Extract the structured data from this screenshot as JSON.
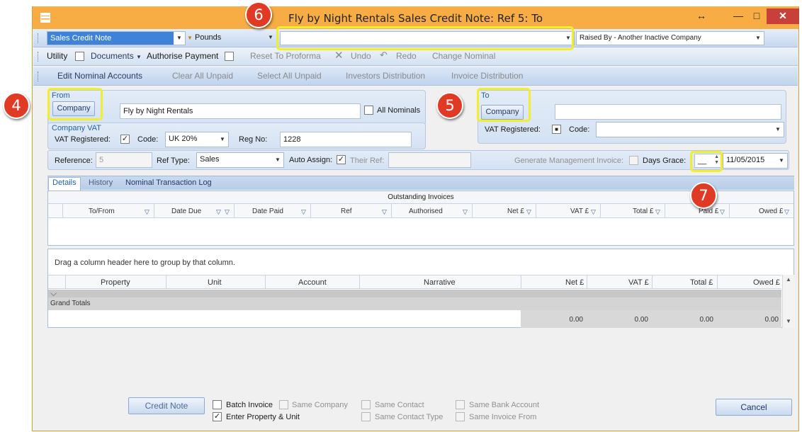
{
  "window": {
    "title": "Fly by Night Rentals Sales Credit Note: Ref 5: To",
    "controls": {
      "restore": "↔",
      "minimize": "—",
      "maximize": "□",
      "close": "✕"
    }
  },
  "toolbar1": {
    "doc_type": "Sales Credit Note",
    "currency": "Pounds",
    "middle_combo": "",
    "raised_by": "Raised By - Another Inactive Company"
  },
  "toolbar2": {
    "utility": "Utility",
    "documents": "Documents",
    "authorise_payment": "Authorise Payment",
    "reset_to_proforma": "Reset To Proforma",
    "undo": "Undo",
    "redo": "Redo",
    "change_nominal": "Change Nominal"
  },
  "toolbar3": {
    "edit_nominal": "Edit Nominal Accounts",
    "clear_all_unpaid": "Clear All Unpaid",
    "select_all_unpaid": "Select All Unpaid",
    "investors_distribution": "Investors Distribution",
    "invoice_distribution": "Invoice Distribution"
  },
  "from": {
    "label": "From",
    "company_button": "Company",
    "company_name": "Fly by Night Rentals",
    "all_nominals": "All Nominals",
    "company_vat": "Company VAT",
    "vat_registered": "VAT Registered:",
    "code_label": "Code:",
    "code_value": "UK 20%",
    "reg_no_label": "Reg No:",
    "reg_no_value": "1228"
  },
  "to": {
    "label": "To",
    "company_button": "Company",
    "company_name": "",
    "vat_registered": "VAT Registered:",
    "code_label": "Code:",
    "code_value": ""
  },
  "reference": {
    "reference_label": "Reference:",
    "reference_value": "5",
    "ref_type_label": "Ref Type:",
    "ref_type_value": "Sales",
    "auto_assign": "Auto Assign:",
    "their_ref": "Their Ref:",
    "their_ref_value": "",
    "generate_mgmt": "Generate Management Invoice:",
    "days_grace": "Days Grace:",
    "days_grace_value": "__",
    "date_value": "11/05/2015"
  },
  "tabs": [
    "Details",
    "History",
    "Nominal Transaction Log"
  ],
  "outstanding": {
    "title": "Outstanding Invoices",
    "columns": [
      "To/From",
      "Date Due",
      "Date Paid",
      "Ref",
      "Authorised",
      "Net £",
      "VAT £",
      "Total £",
      "Paid £",
      "Owed £"
    ]
  },
  "lines": {
    "group_hint": "Drag a column header here to group by that column.",
    "columns": [
      "Property",
      "Unit",
      "Account",
      "Narrative",
      "Net £",
      "VAT £",
      "Total £",
      "Owed £"
    ],
    "grand_totals": "Grand Totals",
    "totals": [
      "0.00",
      "0.00",
      "0.00",
      "0.00"
    ]
  },
  "footer": {
    "credit_note": "Credit Note",
    "batch_invoice": "Batch Invoice",
    "enter_property_unit": "Enter Property & Unit",
    "same_company": "Same Company",
    "same_contact": "Same Contact",
    "same_contact_type": "Same Contact Type",
    "same_bank_account": "Same Bank Account",
    "same_invoice_from": "Same Invoice From",
    "cancel": "Cancel"
  },
  "callouts": [
    "4",
    "5",
    "6",
    "7"
  ],
  "colors": {
    "titlebar": "#f7ad44",
    "highlight": "#f2ee2b",
    "badge": "#e03a25"
  }
}
